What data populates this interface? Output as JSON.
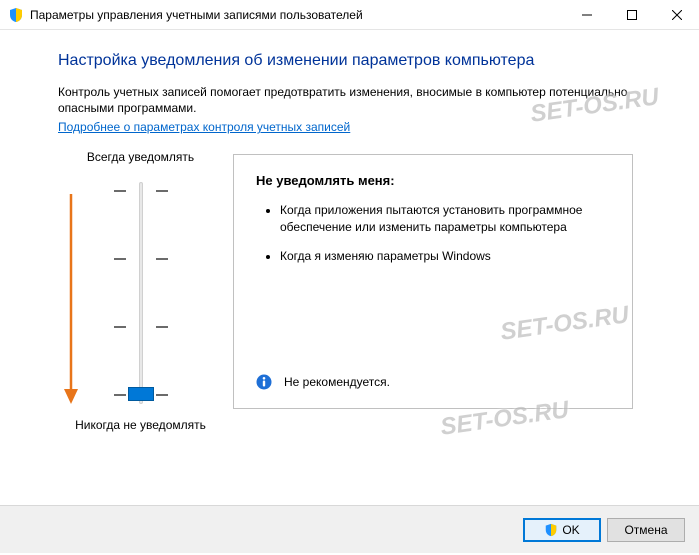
{
  "titlebar": {
    "text": "Параметры управления учетными записями пользователей"
  },
  "content": {
    "heading": "Настройка уведомления об изменении параметров компьютера",
    "desc": "Контроль учетных записей помогает предотвратить изменения, вносимые в компьютер потенциально опасными программами.",
    "link": "Подробнее о параметрах контроля учетных записей"
  },
  "slider": {
    "top_label": "Всегда уведомлять",
    "bottom_label": "Никогда не уведомлять"
  },
  "infobox": {
    "title": "Не уведомлять меня:",
    "items": [
      "Когда приложения пытаются установить программное обеспечение или изменить параметры компьютера",
      "Когда я изменяю параметры Windows"
    ],
    "footer": "Не рекомендуется."
  },
  "buttons": {
    "ok": "OK",
    "cancel": "Отмена"
  },
  "watermark": "SET-OS.RU"
}
